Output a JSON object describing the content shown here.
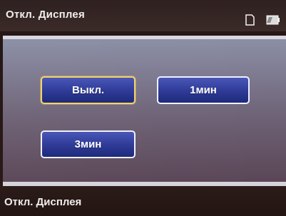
{
  "header": {
    "title": "Откл. Дисплея",
    "icons": [
      "sd-card-icon",
      "battery-icon"
    ]
  },
  "options": {
    "off_label": "Выкл.",
    "one_min_label": "1мин",
    "three_min_label": "3мин",
    "selected": "Выкл."
  },
  "footer": {
    "title": "Откл. Дисплея"
  },
  "colors": {
    "button_fill": "#2e3a96",
    "selected_border": "#f3d26a",
    "panel_top": "#8b8fa6",
    "panel_bottom": "#5a4656"
  }
}
